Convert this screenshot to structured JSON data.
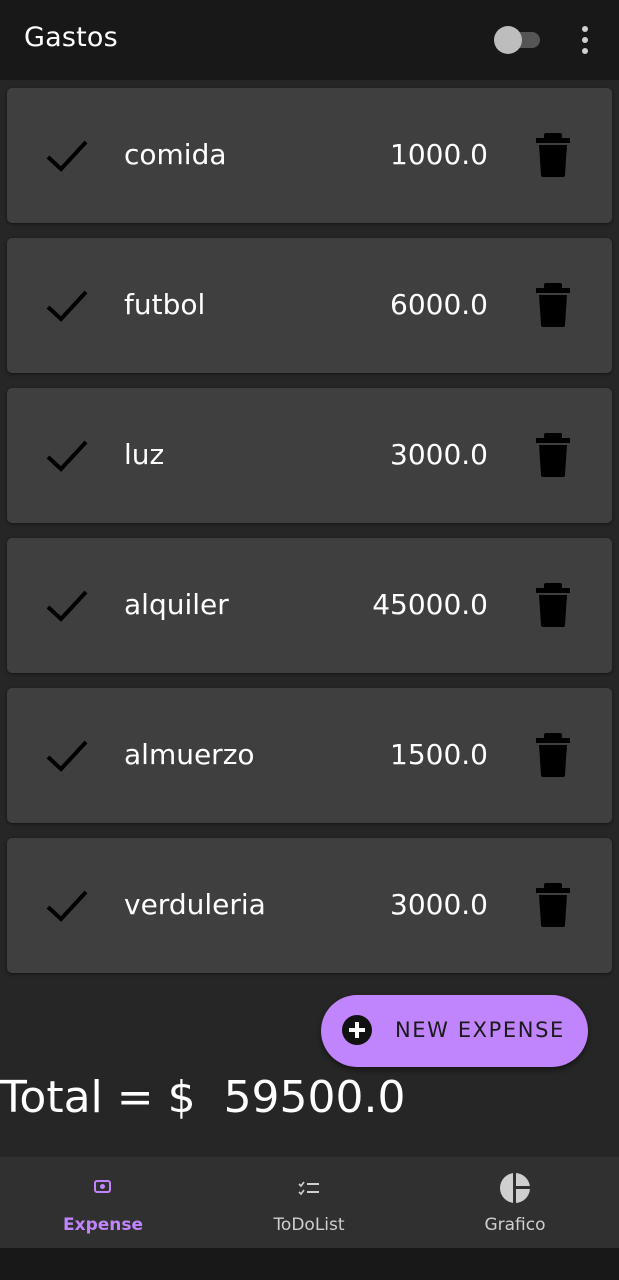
{
  "appbar": {
    "title": "Gastos",
    "toggle_state": "off",
    "toggle_icon": "toggle-switch-icon",
    "menu_icon": "more-vert-icon"
  },
  "expenses": [
    {
      "name": "comida",
      "amount": "1000.0"
    },
    {
      "name": "futbol",
      "amount": "6000.0"
    },
    {
      "name": "luz",
      "amount": "3000.0"
    },
    {
      "name": "alquiler",
      "amount": "45000.0"
    },
    {
      "name": "almuerzo",
      "amount": "1500.0"
    },
    {
      "name": "verduleria",
      "amount": "3000.0"
    }
  ],
  "row_icons": {
    "check": "check-icon",
    "delete": "trash-icon"
  },
  "fab": {
    "label": "NEW EXPENSE",
    "icon": "add-circle-icon"
  },
  "total": {
    "text": "Total = $  59500.0"
  },
  "bottom_nav": {
    "items": [
      {
        "label": "Expense",
        "icon": "money-icon",
        "active": true
      },
      {
        "label": "ToDoList",
        "icon": "checklist-icon",
        "active": false
      },
      {
        "label": "Grafico",
        "icon": "pie-chart-icon",
        "active": false
      }
    ]
  },
  "colors": {
    "accent": "#c084fc",
    "background": "#262626",
    "appbar": "#181818",
    "card": "#3f3f3f",
    "bottom_nav": "#303030"
  }
}
